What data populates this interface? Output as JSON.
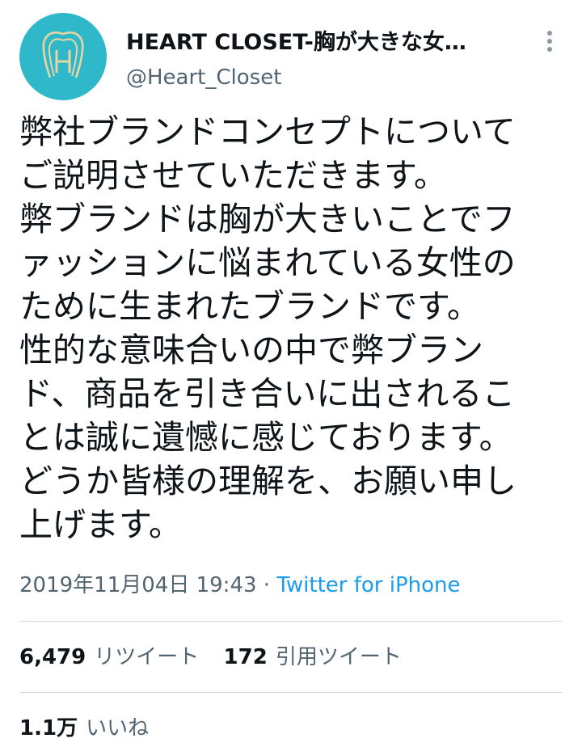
{
  "profile": {
    "display_name": "HEART CLOSET-胸が大きな女…",
    "handle": "@Heart_Closet",
    "avatar_icon": "heart-h-logo-icon",
    "avatar_color": "#2eb8c9",
    "more_icon": "vertical-ellipsis-icon"
  },
  "tweet": {
    "lines": [
      "弊社ブランドコンセプトについて",
      "ご説明させていただきます。",
      "弊ブランドは胸が大きいことでフ",
      "ァッションに悩まれている女性の",
      "ために生まれたブランドです。",
      "性的な意味合いの中で弊ブラン",
      "ド、商品を引き合いに出されるこ",
      "とは誠に遺憾に感じております。",
      "どうか皆様の理解を、お願い申し",
      "上げます。"
    ]
  },
  "meta": {
    "timestamp": "2019年11月04日 19:43",
    "separator": "·",
    "source": "Twitter for iPhone"
  },
  "stats": {
    "retweets": {
      "count": "6,479",
      "label": "リツイート"
    },
    "quotes": {
      "count": "172",
      "label": "引用ツイート"
    },
    "likes": {
      "count": "1.1万",
      "label": "いいね"
    }
  },
  "colors": {
    "text": "#0f1419",
    "secondary": "#536471",
    "link": "#1d9bf0",
    "divider": "#cfd9de"
  }
}
